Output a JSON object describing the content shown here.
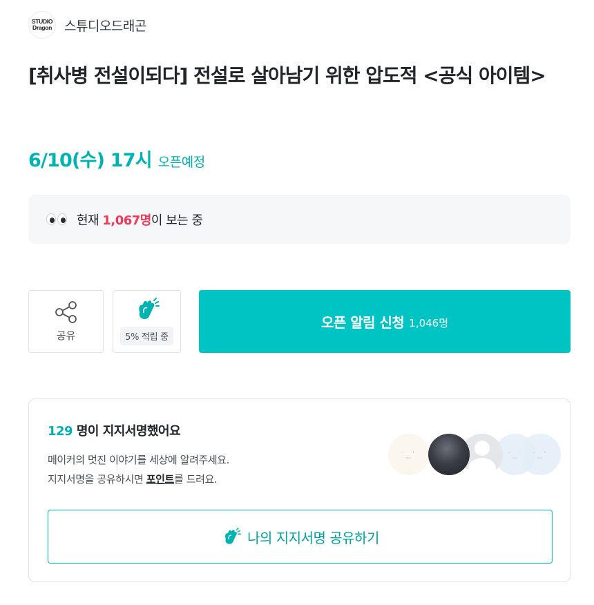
{
  "maker": {
    "logo_line1": "STUDIO",
    "logo_line2": "Dragon",
    "name": "스튜디오드래곤"
  },
  "project": {
    "title": "[취사병 전설이되다] 전설로 살아남기 위한 압도적 <공식 아이템>",
    "open_date": "6/10(수) 17시",
    "open_status": "오픈예정"
  },
  "viewers": {
    "prefix": "현재 ",
    "count": "1,067명",
    "suffix": "이 보는 중"
  },
  "actions": {
    "share_label": "공유",
    "cheer_badge": "5% 적립 중",
    "notify_label": "오픈 알림 신청",
    "notify_count": "1,046명"
  },
  "support": {
    "count": "129",
    "title_suffix": " 명이 지지서명했어요",
    "desc_line1": "메이커의 멋진 이야기를 세상에 알려주세요.",
    "desc_line2_prefix": "지지서명을 공유하시면 ",
    "desc_point": "포인트",
    "desc_line2_suffix": "를 드려요.",
    "share_button_label": "나의 지지서명 공유하기"
  },
  "colors": {
    "accent": "#00c4c4",
    "accent_text": "#00b2b2",
    "highlight": "#f2385a"
  }
}
